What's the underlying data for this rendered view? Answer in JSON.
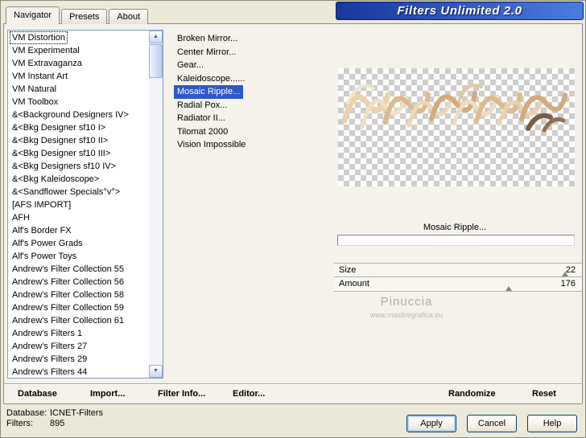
{
  "window": {
    "title": "Filters Unlimited 2.0"
  },
  "tabs": [
    {
      "label": "Navigator",
      "active": true
    },
    {
      "label": "Presets"
    },
    {
      "label": "About"
    }
  ],
  "left_list": {
    "focus_index": 0,
    "items": [
      "VM Distortion",
      "VM Experimental",
      "VM Extravaganza",
      "VM Instant Art",
      "VM Natural",
      "VM Toolbox",
      "&<Background Designers IV>",
      "&<Bkg Designer sf10 I>",
      "&<Bkg Designer sf10 II>",
      "&<Bkg Designer sf10 III>",
      "&<Bkg Designers sf10 IV>",
      "&<Bkg Kaleidoscope>",
      "&<Sandflower Specials°v°>",
      "[AFS IMPORT]",
      "AFH",
      "Alf's Border FX",
      "Alf's Power Grads",
      "Alf's Power Toys",
      "Andrew's Filter Collection 55",
      "Andrew's Filter Collection 56",
      "Andrew's Filter Collection 58",
      "Andrew's Filter Collection 59",
      "Andrew's Filter Collection 61",
      "Andrew's Filters 1",
      "Andrew's Filters 27",
      "Andrew's Filters 29",
      "Andrew's Filters 44"
    ]
  },
  "filter_list": {
    "selected_index": 4,
    "items": [
      "Broken Mirror...",
      "Center Mirror...",
      "Gear...",
      "Kaleidoscope......",
      "Mosaic Ripple...",
      "Radial Pox...",
      "Radiator II...",
      "Tilomat 2000",
      "Vision Impossible"
    ]
  },
  "preview": {
    "filter_name": "Mosaic Ripple...",
    "watermark_name": "Pinuccia",
    "watermark_url": "www.maidiregrafica.eu"
  },
  "params": [
    {
      "name": "Size",
      "value": "22",
      "thumb_pct": 92
    },
    {
      "name": "Amount",
      "value": "176",
      "thumb_pct": 69
    }
  ],
  "toolbar": {
    "database": "Database",
    "import_btn": "Import...",
    "filter_info": "Filter Info...",
    "editor": "Editor...",
    "randomize": "Randomize",
    "reset": "Reset"
  },
  "status": {
    "database_label": "Database:",
    "database_value": "ICNET-Filters",
    "filters_label": "Filters:",
    "filters_value": "895"
  },
  "action_buttons": {
    "apply": "Apply",
    "cancel": "Cancel",
    "help": "Help"
  },
  "colors": {
    "dialog_bg": "#ece9d8",
    "page_bg": "#f4f2ea",
    "selection": "#2e58c8",
    "title_grad_left": "#17379e",
    "title_grad_right": "#4b7be0",
    "button_border": "#003c74"
  }
}
